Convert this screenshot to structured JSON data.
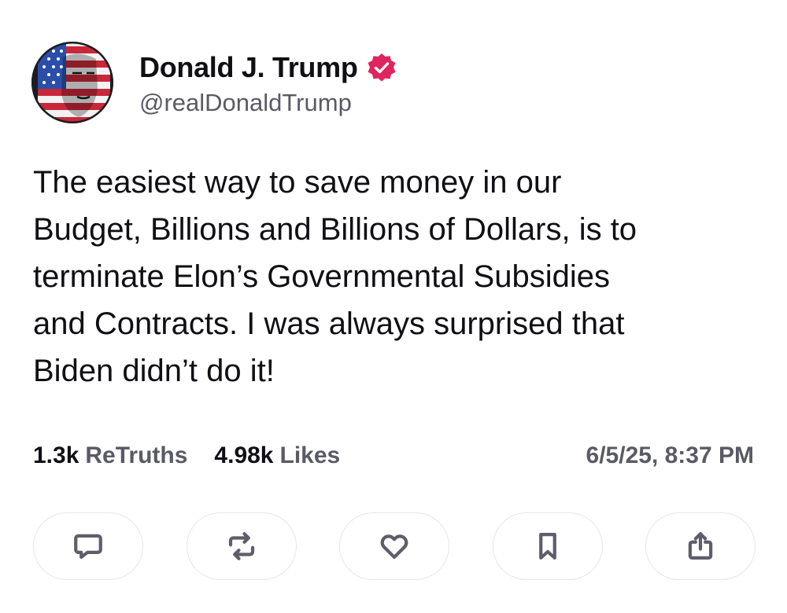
{
  "author": {
    "display_name": "Donald J. Trump",
    "handle": "@realDonaldTrump",
    "verified": true,
    "verified_color": "#e0245e",
    "avatar_icon": "avatar-flag-portrait"
  },
  "post": {
    "text": "The easiest way to save money in our\nBudget, Billions and Billions of Dollars, is to\nterminate Elon’s Governmental Subsidies\nand Contracts. I was always surprised that\nBiden didn’t do it!"
  },
  "stats": {
    "retruths_count": "1.3k",
    "retruths_label": "ReTruths",
    "likes_count": "4.98k",
    "likes_label": "Likes",
    "timestamp": "6/5/25, 8:37 PM"
  },
  "actions": [
    {
      "name": "reply",
      "icon": "comment-icon"
    },
    {
      "name": "retruth",
      "icon": "repost-icon"
    },
    {
      "name": "like",
      "icon": "heart-icon"
    },
    {
      "name": "bookmark",
      "icon": "bookmark-icon"
    },
    {
      "name": "share",
      "icon": "share-icon"
    }
  ],
  "colors": {
    "text": "#0f0f14",
    "muted": "#5a5a66",
    "button_border": "#e6e6ea",
    "icon": "#5e5e6b"
  }
}
